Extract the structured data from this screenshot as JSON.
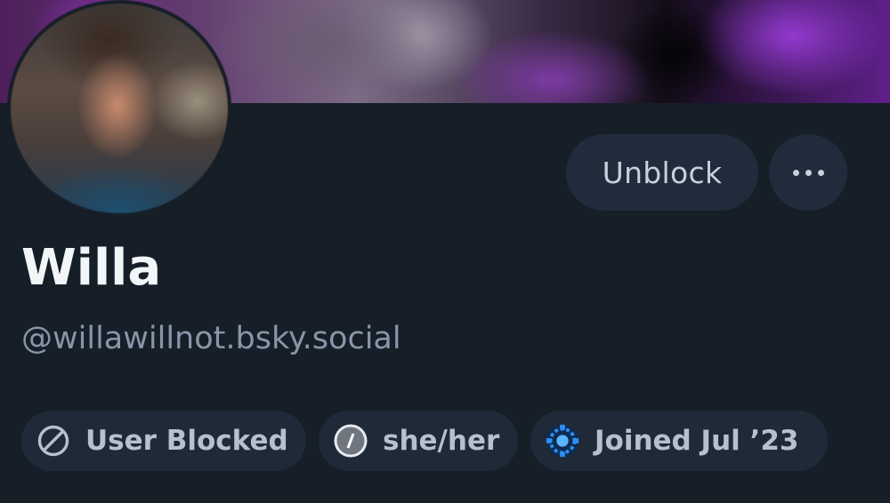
{
  "profile": {
    "display_name": "Willa",
    "handle": "@willawillnot.bsky.social"
  },
  "actions": {
    "unblock_label": "Unblock",
    "more_icon": "more-horizontal-icon"
  },
  "badges": [
    {
      "label": "User Blocked",
      "icon": "blocked-icon"
    },
    {
      "label": "she/her",
      "icon": "pronouns-icon"
    },
    {
      "label": "Joined Jul ’23",
      "icon": "joined-icon"
    }
  ],
  "colors": {
    "background": "#161e27",
    "button_bg": "#202c3b",
    "pill_bg": "#1f2a38",
    "name_text": "#f3f6f9",
    "handle_text": "#8796a8",
    "joined_icon_accent": "#2f8ff5"
  }
}
